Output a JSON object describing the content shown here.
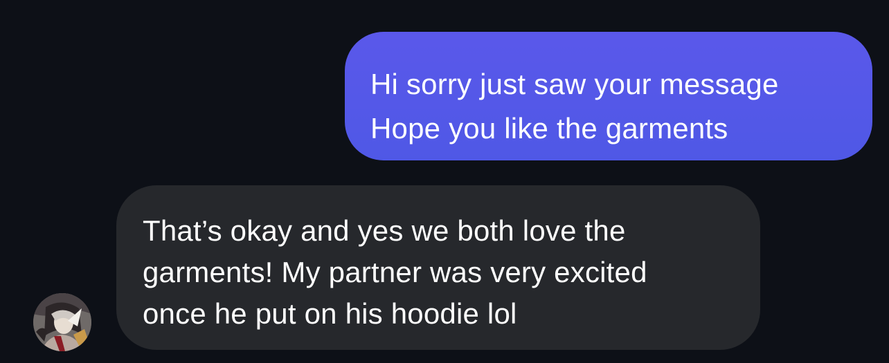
{
  "conversation": {
    "sent_message": {
      "lines": [
        "Hi sorry just saw your message",
        "Hope you like the garments"
      ]
    },
    "received_message": {
      "lines": [
        "That’s okay and yes we both love the",
        "garments! My partner was very excited",
        "once he put on his hoodie lol"
      ]
    }
  },
  "colors": {
    "background": "#0d1017",
    "sent_bubble": "#5a58ea",
    "received_bubble": "#26282c",
    "text": "#ffffff"
  }
}
